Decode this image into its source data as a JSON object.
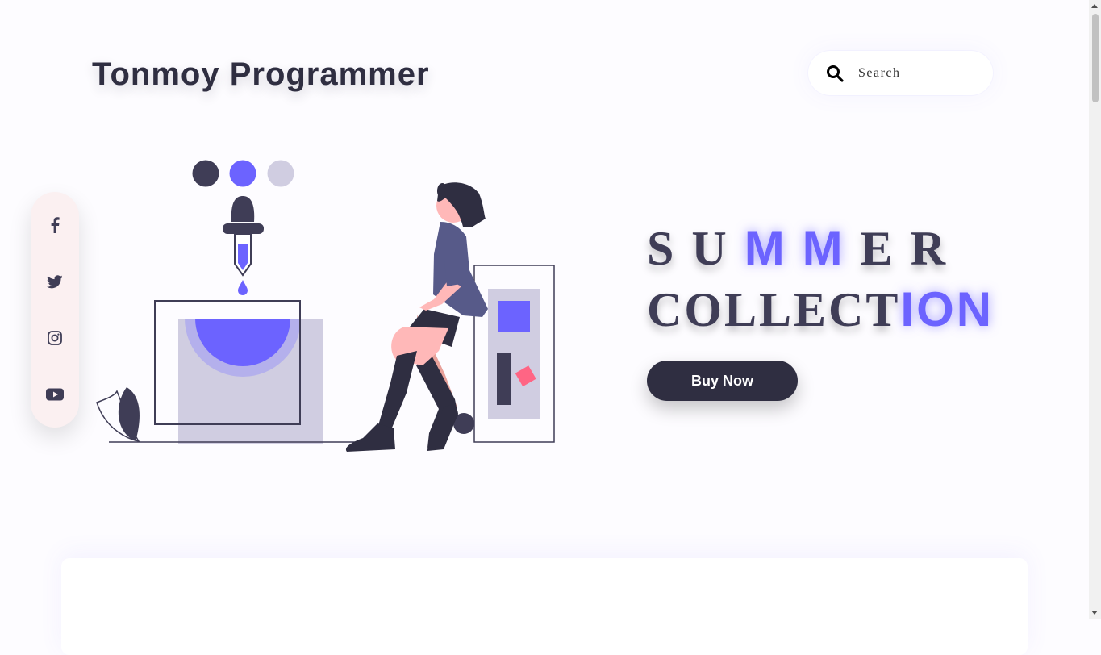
{
  "header": {
    "brand": "Tonmoy Programmer",
    "search": {
      "placeholder": "Search",
      "icon": "search-icon"
    }
  },
  "social": {
    "items": [
      {
        "icon": "facebook-icon"
      },
      {
        "icon": "twitter-icon"
      },
      {
        "icon": "instagram-icon"
      },
      {
        "icon": "youtube-icon"
      }
    ]
  },
  "hero": {
    "line1": {
      "part1": "SU",
      "accent": "MM",
      "part2": "ER"
    },
    "line2": {
      "part1": "COLLECT",
      "accent": "ION"
    },
    "button": "Buy Now"
  },
  "colors": {
    "accent": "#6c63ff",
    "dark": "#2f2e41",
    "light_lavender": "#d0cde1",
    "pink_panel": "#fbf0f1"
  }
}
